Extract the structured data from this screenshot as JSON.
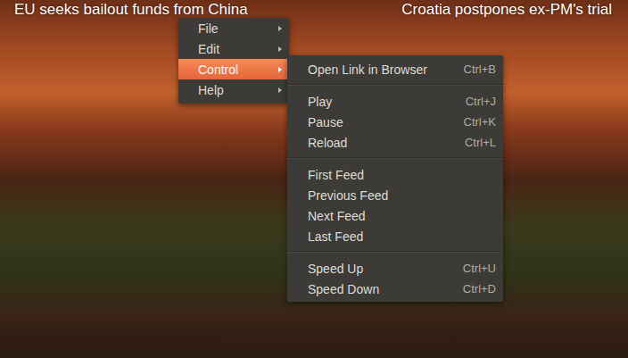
{
  "ticker": {
    "items": [
      "EU seeks bailout funds from China",
      "Croatia postpones ex-PM's trial"
    ]
  },
  "menu": {
    "items": [
      {
        "label": "File",
        "has_submenu": true,
        "selected": false
      },
      {
        "label": "Edit",
        "has_submenu": true,
        "selected": false
      },
      {
        "label": "Control",
        "has_submenu": true,
        "selected": true
      },
      {
        "label": "Help",
        "has_submenu": true,
        "selected": false
      }
    ]
  },
  "submenu": {
    "groups": [
      [
        {
          "label": "Open Link in Browser",
          "shortcut": "Ctrl+B"
        }
      ],
      [
        {
          "label": "Play",
          "shortcut": "Ctrl+J"
        },
        {
          "label": "Pause",
          "shortcut": "Ctrl+K"
        },
        {
          "label": "Reload",
          "shortcut": "Ctrl+L"
        }
      ],
      [
        {
          "label": "First Feed"
        },
        {
          "label": "Previous Feed"
        },
        {
          "label": "Next Feed"
        },
        {
          "label": "Last Feed"
        }
      ],
      [
        {
          "label": "Speed Up",
          "shortcut": "Ctrl+U"
        },
        {
          "label": "Speed Down",
          "shortcut": "Ctrl+D"
        }
      ]
    ]
  }
}
